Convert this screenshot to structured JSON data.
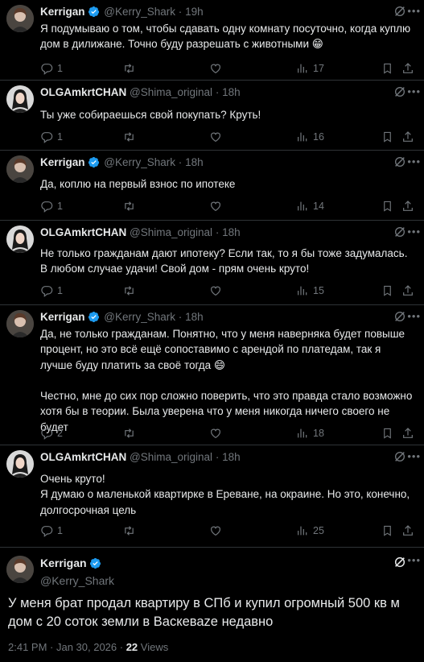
{
  "thread": [
    {
      "name": "Kerrigan",
      "verified": true,
      "handle": "@Kerry_Shark",
      "time": "19h",
      "text": "Я подумываю о том, чтобы сдавать одну комнату посуточно, когда куплю дом в дилижане. Точно буду разрешать с животными 😁",
      "reply": "1",
      "retweet": "",
      "like": "",
      "views": "17"
    },
    {
      "name": "OLGAmkrtCHAN",
      "verified": false,
      "handle": "@Shima_original",
      "time": "18h",
      "text": "Ты уже собираешься свой покупать? Круть!",
      "reply": "1",
      "retweet": "",
      "like": "",
      "views": "16"
    },
    {
      "name": "Kerrigan",
      "verified": true,
      "handle": "@Kerry_Shark",
      "time": "18h",
      "text": "Да, коплю на первый взнос по ипотеке",
      "reply": "1",
      "retweet": "",
      "like": "",
      "views": "14"
    },
    {
      "name": "OLGAmkrtCHAN",
      "verified": false,
      "handle": "@Shima_original",
      "time": "18h",
      "text": "Не только гражданам дают ипотеку? Если так, то я бы тоже задумалась. В любом случае удачи! Свой дом - прям очень круто!",
      "reply": "1",
      "retweet": "",
      "like": "",
      "views": "15"
    },
    {
      "name": "Kerrigan",
      "verified": true,
      "handle": "@Kerry_Shark",
      "time": "18h",
      "text": "Да, не только гражданам. Понятно, что у меня наверняка будет повыше процент, но это всё ещё сопоставимо с арендой по платедам, так я лучше буду платить за своё тогда 😄\n\nЧестно, мне до сих пор сложно поверить, что это правда стало возможно хотя бы в теории. Была уверена что у меня никогда ничего своего не будет",
      "reply": "2",
      "retweet": "",
      "like": "",
      "views": "18"
    },
    {
      "name": "OLGAmkrtCHAN",
      "verified": false,
      "handle": "@Shima_original",
      "time": "18h",
      "text": "Очень круто!\nЯ думаю о маленькой квартирке в Ереване, на окраине. Но это, конечно, долгосрочная цель",
      "reply": "1",
      "retweet": "",
      "like": "",
      "views": "25"
    }
  ],
  "main": {
    "name": "Kerrigan",
    "handle": "@Kerry_Shark",
    "text": "У меня брат продал квартиру в СПб и купил огромный 500 кв м дом с 20 соток земли в Васкеваze недавно",
    "timestamp": "2:41 PM · Jan 30, 2026 · ",
    "views_count": "22",
    "views_label": " Views"
  },
  "colors": {
    "verified": "#1d9bf0",
    "muted": "#71767b",
    "text": "#e7e9ea",
    "divider": "#2f3336"
  }
}
